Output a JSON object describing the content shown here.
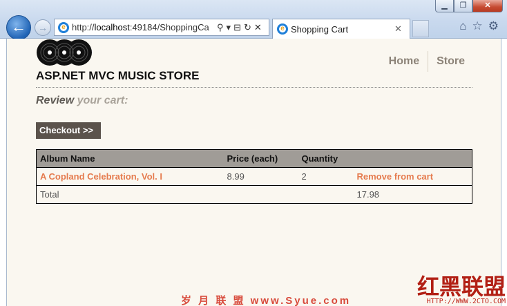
{
  "browser": {
    "url_prefix": "http://",
    "url_host": "localhost",
    "url_rest": ":49184/ShoppingCa",
    "tab_title": "Shopping Cart",
    "window_controls": {
      "minimize": "▁",
      "restore": "❐",
      "close": "✕"
    },
    "tools": {
      "search": "⚲",
      "dropdown": "▾",
      "compat": "⊟",
      "refresh": "↻",
      "stop": "✕",
      "home": "⌂",
      "favorites": "☆",
      "settings": "⚙"
    }
  },
  "site": {
    "title": "ASP.NET MVC MUSIC STORE",
    "nav": [
      "Home",
      "Store"
    ]
  },
  "cart": {
    "heading_bold": "Review",
    "heading_light": "your cart:",
    "checkout_label": "Checkout >>",
    "columns": [
      "Album Name",
      "Price (each)",
      "Quantity",
      ""
    ],
    "rows": [
      {
        "album": "A Copland Celebration, Vol. I",
        "price": "8.99",
        "quantity": "2",
        "action": "Remove from cart"
      }
    ],
    "total_label": "Total",
    "total_value": "17.98"
  },
  "watermarks": {
    "left": "岁 月 联 盟  www.Syue.com",
    "right": "红黑联盟",
    "right_url": "HTTP://WWW.2CTO.COM"
  },
  "colors": {
    "accent": "#e57b4e",
    "checkout_bg": "#5b534c",
    "page_bg": "#faf7f0",
    "table_header_bg": "#a09c97"
  }
}
